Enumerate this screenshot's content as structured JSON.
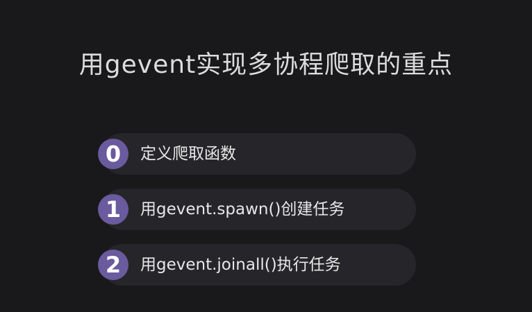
{
  "title": "用gevent实现多协程爬取的重点",
  "steps": [
    {
      "number": "0",
      "text": "定义爬取函数"
    },
    {
      "number": "1",
      "text": "用gevent.spawn()创建任务"
    },
    {
      "number": "2",
      "text": "用gevent.joinall()执行任务"
    }
  ],
  "colors": {
    "background": "#19181b",
    "pill": "#262529",
    "badge": "#6a5a9e",
    "text": "#e8e8e8"
  }
}
